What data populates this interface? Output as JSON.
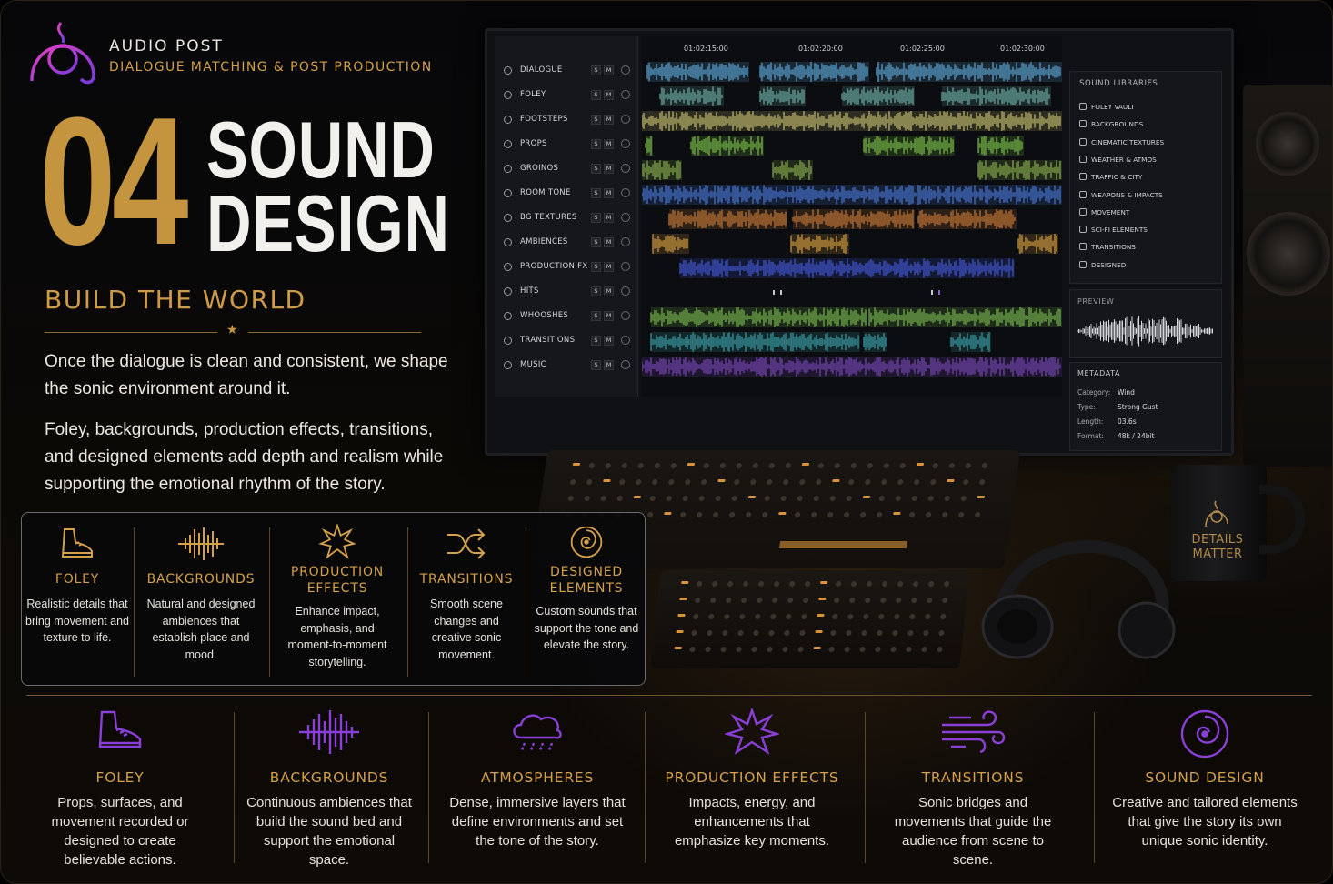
{
  "brand": {
    "title": "AUDIO POST",
    "subtitle": "DIALOGUE MATCHING & POST PRODUCTION",
    "logo_icon": "audio-post-logo-icon"
  },
  "hero": {
    "number": "04",
    "title_line_1": "SOUND",
    "title_line_2": "DESIGN",
    "section_title": "BUILD THE WORLD",
    "paragraph_1": "Once the dialogue is clean and consistent, we shape the sonic environment around it.",
    "paragraph_2": "Foley, backgrounds, production effects, transitions, and designed elements add depth and realism while supporting the emotional rhythm of the story."
  },
  "card": {
    "items": [
      {
        "icon": "shoe-icon",
        "title": "FOLEY",
        "desc": "Realistic details that bring movement and texture to life."
      },
      {
        "icon": "waveform-icon",
        "title": "BACKGROUNDS",
        "desc": "Natural and designed ambiences that establish place and mood."
      },
      {
        "icon": "burst-icon",
        "title": "PRODUCTION EFFECTS",
        "desc": "Enhance impact, emphasis, and moment-to-moment storytelling."
      },
      {
        "icon": "shuffle-icon",
        "title": "TRANSITIONS",
        "desc": "Smooth scene changes and creative sonic movement."
      },
      {
        "icon": "spiral-icon",
        "title": "DESIGNED ELEMENTS",
        "desc": "Custom sounds that support the tone and elevate the story."
      }
    ]
  },
  "bottom": {
    "items": [
      {
        "icon": "shoe-icon",
        "title": "FOLEY",
        "desc": "Props, surfaces, and movement recorded or designed to create believable actions."
      },
      {
        "icon": "waveform-icon",
        "title": "BACKGROUNDS",
        "desc": "Continuous ambiences that build the sound bed and support the emotional space."
      },
      {
        "icon": "rain-cloud-icon",
        "title": "ATMOSPHERES",
        "desc": "Dense, immersive layers that define environments and set the tone of the story."
      },
      {
        "icon": "burst-icon",
        "title": "PRODUCTION EFFECTS",
        "desc": "Impacts, energy, and enhancements that emphasize key moments."
      },
      {
        "icon": "wind-icon",
        "title": "TRANSITIONS",
        "desc": "Sonic bridges and movements that guide the audience from scene to scene."
      },
      {
        "icon": "spiral-icon",
        "title": "SOUND DESIGN",
        "desc": "Creative and tailored elements that give the story its own unique sonic identity."
      }
    ]
  },
  "daw": {
    "tracks": [
      {
        "name": "DIALOGUE",
        "color": "#5fa8d8"
      },
      {
        "name": "FOLEY",
        "color": "#6fb0a8"
      },
      {
        "name": "FOOTSTEPS",
        "color": "#c8c070"
      },
      {
        "name": "PROPS",
        "color": "#7cc04a"
      },
      {
        "name": "GROINOS",
        "color": "#8ab050"
      },
      {
        "name": "ROOM TONE",
        "color": "#4a78d8"
      },
      {
        "name": "BG TEXTURES",
        "color": "#c87a38"
      },
      {
        "name": "AMBIENCES",
        "color": "#d8a040"
      },
      {
        "name": "PRODUCTION FX",
        "color": "#4458d8"
      },
      {
        "name": "HITS",
        "color": "#9aa0c0"
      },
      {
        "name": "WHOOSHES",
        "color": "#78b850"
      },
      {
        "name": "TRANSITIONS",
        "color": "#3aa0a8"
      },
      {
        "name": "MUSIC",
        "color": "#7848b8"
      }
    ],
    "solo_label": "S",
    "mute_label": "M",
    "timecodes": [
      "01:02:15:00",
      "01:02:20:00",
      "01:02:25:00",
      "01:02:30:00"
    ],
    "libraries_title": "SOUND LIBRARIES",
    "libraries": [
      "FOLEY VAULT",
      "BACKGROUNDS",
      "CINEMATIC TEXTURES",
      "WEATHER & ATMOS",
      "TRAFFIC & CITY",
      "WEAPONS & IMPACTS",
      "MOVEMENT",
      "SCI-FI ELEMENTS",
      "TRANSITIONS",
      "DESIGNED"
    ],
    "preview_title": "PREVIEW",
    "metadata_title": "METADATA",
    "metadata": [
      {
        "key": "Category:",
        "value": "Wind"
      },
      {
        "key": "Type:",
        "value": "Strong Gust"
      },
      {
        "key": "Length:",
        "value": "03.6s"
      },
      {
        "key": "Format:",
        "value": "48k / 24bit"
      }
    ]
  },
  "mug": {
    "text_line_1": "DETAILS",
    "text_line_2": "MATTER"
  },
  "colors": {
    "gold": "#c4943e",
    "gold_text": "#d4a04a",
    "purple_icon": "#8a3fd8",
    "logo_magenta": "#c83ad0"
  }
}
